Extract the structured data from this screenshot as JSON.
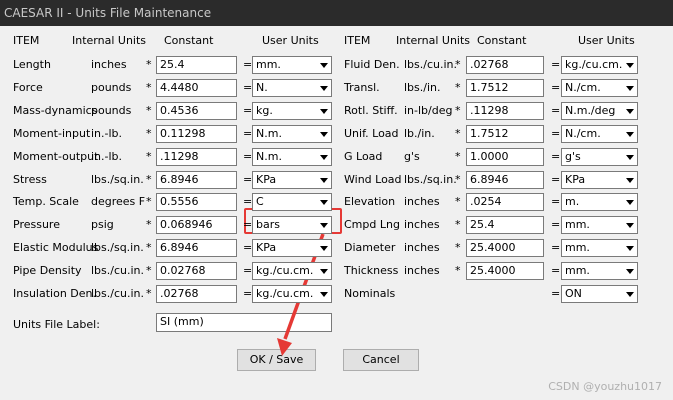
{
  "window": {
    "title": "CAESAR II  -  Units File Maintenance"
  },
  "headers": {
    "left": {
      "item": "ITEM",
      "internal": "Internal Units",
      "constant": "Constant",
      "user": "User Units"
    },
    "right": {
      "item": "ITEM",
      "internal": "Internal Units",
      "constant": "Constant",
      "user": "User Units"
    }
  },
  "left_rows": [
    {
      "item": "Length",
      "internal": "inches",
      "constant": "25.4",
      "user": "mm."
    },
    {
      "item": "Force",
      "internal": "pounds",
      "constant": "4.4480",
      "user": "N."
    },
    {
      "item": "Mass-dynamics",
      "internal": "pounds",
      "constant": "0.4536",
      "user": "kg."
    },
    {
      "item": "Moment-input",
      "internal": "in.-lb.",
      "constant": "0.11298",
      "user": "N.m."
    },
    {
      "item": "Moment-output",
      "internal": "in.-lb.",
      "constant": ".11298",
      "user": "N.m."
    },
    {
      "item": "Stress",
      "internal": "lbs./sq.in.",
      "constant": "6.8946",
      "user": "KPa"
    },
    {
      "item": "Temp. Scale",
      "internal": "degrees F",
      "constant": "0.5556",
      "user": "C"
    },
    {
      "item": "Pressure",
      "internal": "psig",
      "constant": "0.068946",
      "user": "bars"
    },
    {
      "item": "Elastic Modulus",
      "internal": "lbs./sq.in.",
      "constant": "6.8946",
      "user": "KPa"
    },
    {
      "item": "Pipe Density",
      "internal": "lbs./cu.in.",
      "constant": "0.02768",
      "user": "kg./cu.cm."
    },
    {
      "item": "Insulation Den.",
      "internal": "lbs./cu.in.",
      "constant": ".02768",
      "user": "kg./cu.cm."
    }
  ],
  "right_rows": [
    {
      "item": "Fluid Den.",
      "internal": "lbs./cu.in.",
      "constant": ".02768",
      "user": "kg./cu.cm."
    },
    {
      "item": "Transl.",
      "internal": "lbs./in.",
      "constant": "1.7512",
      "user": "N./cm."
    },
    {
      "item": "Rotl. Stiff.",
      "internal": "in-lb/deg",
      "constant": ".11298",
      "user": "N.m./deg"
    },
    {
      "item": "Unif. Load",
      "internal": "lb./in.",
      "constant": "1.7512",
      "user": "N./cm."
    },
    {
      "item": "G Load",
      "internal": "g's",
      "constant": "1.0000",
      "user": "g's"
    },
    {
      "item": "Wind Load",
      "internal": "lbs./sq.in.",
      "constant": "6.8946",
      "user": "KPa"
    },
    {
      "item": "Elevation",
      "internal": "inches",
      "constant": ".0254",
      "user": "m."
    },
    {
      "item": "Cmpd Lng",
      "internal": "inches",
      "constant": "25.4",
      "user": "mm."
    },
    {
      "item": "Diameter",
      "internal": "inches",
      "constant": "25.4000",
      "user": "mm."
    },
    {
      "item": "Thickness",
      "internal": "inches",
      "constant": "25.4000",
      "user": "mm."
    },
    {
      "item": "Nominals",
      "internal": "",
      "constant": "",
      "user": "ON"
    }
  ],
  "operators": {
    "multiply": "*",
    "equals": "="
  },
  "label_field": {
    "label": "Units File Label:",
    "value": "SI (mm)"
  },
  "buttons": {
    "ok": "OK / Save",
    "cancel": "Cancel"
  },
  "watermark": "CSDN @youzhu1017",
  "colors": {
    "annotation": "#e53935"
  }
}
